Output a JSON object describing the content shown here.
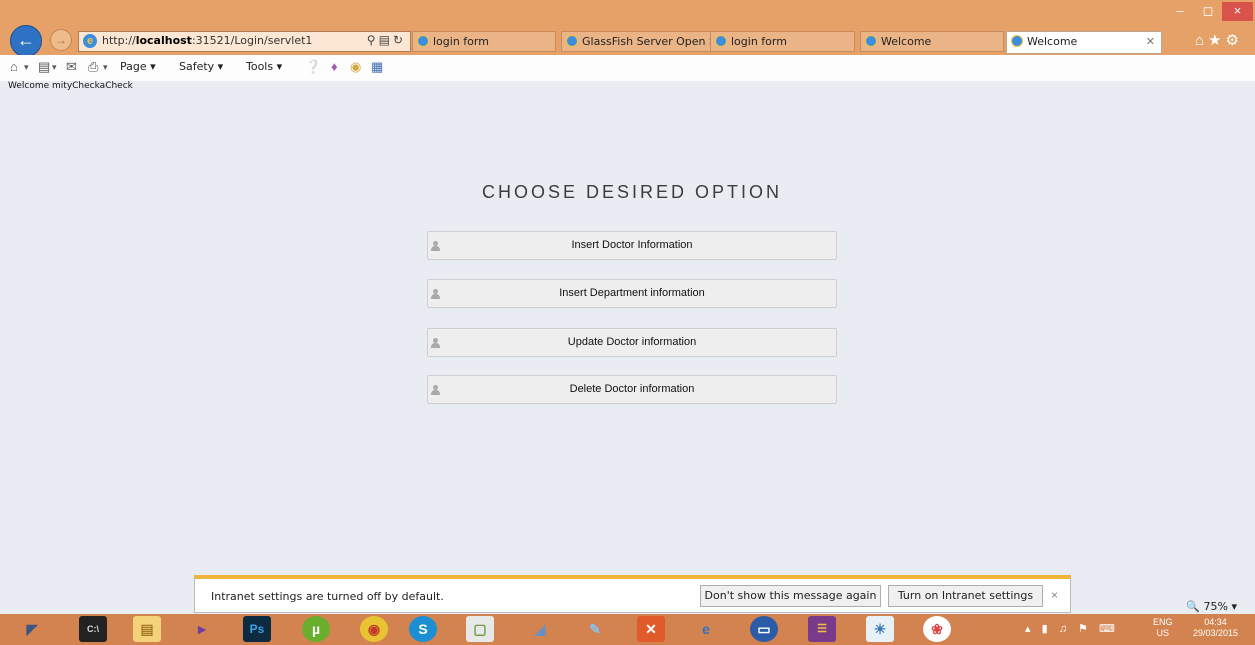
{
  "browser": {
    "address_url_host": "localhost",
    "address_url_prefix": "http://",
    "address_url_suffix": ":31521/Login/servlet1",
    "tabs": [
      {
        "label": "login form",
        "active": false
      },
      {
        "label": "GlassFish Server Open S...",
        "active": false
      },
      {
        "label": "login form",
        "active": false
      },
      {
        "label": "Welcome",
        "active": false
      },
      {
        "label": "Welcome",
        "active": true
      }
    ],
    "window_buttons": {
      "minimize": "–",
      "maximize": "◻",
      "close": "×"
    }
  },
  "command_bar": {
    "page": "Page ▾",
    "safety": "Safety ▾",
    "tools": "Tools ▾"
  },
  "page": {
    "welcome_text": "Welcome mityCheckaCheck",
    "heading": "CHOOSE DESIRED OPTION",
    "options": [
      {
        "label": "Insert Doctor Information"
      },
      {
        "label": "Insert Department information"
      },
      {
        "label": "Update Doctor information"
      },
      {
        "label": "Delete Doctor information"
      }
    ]
  },
  "notification": {
    "message": "Intranet settings are turned off by default.",
    "dont_show_label": "Don't show this message again",
    "turn_on_label": "Turn on Intranet settings",
    "close_label": "×"
  },
  "zoom": "🔍 75%  ▾",
  "taskbar": {
    "lang_line1": "ENG",
    "lang_line2": "US",
    "time": "04:34",
    "date": "29/03/2015"
  },
  "colors": {
    "titlebar": "#e5a167",
    "taskbar": "#d3834f",
    "content_bg": "#e9edf3",
    "notify_accent": "#efb43a"
  }
}
